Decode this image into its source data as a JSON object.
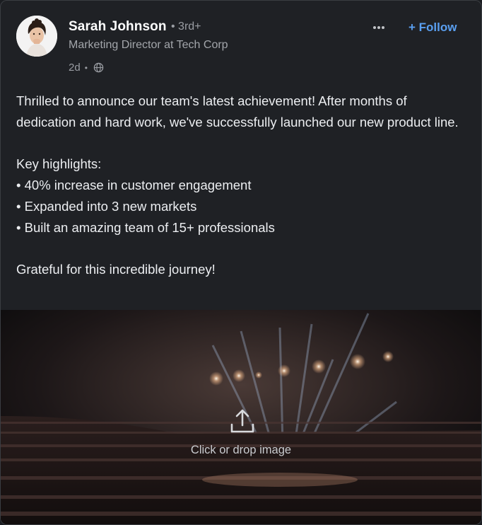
{
  "author": {
    "name": "Sarah Johnson",
    "degree": "3rd+",
    "headline": "Marketing Director at Tech Corp",
    "time": "2d",
    "visibility_icon": "globe-icon",
    "avatar_icon": "profile-photo"
  },
  "actions": {
    "more_icon": "ellipsis-icon",
    "follow_label": "+ Follow"
  },
  "post": {
    "intro": "Thrilled to announce our team's latest achievement! After months of dedication and hard work, we've successfully launched our new product line.",
    "highlights_title": "Key highlights:",
    "highlights": [
      "• 40% increase in customer engagement",
      "• Expanded into 3 new markets",
      "• Built an amazing team of 15+ professionals"
    ],
    "closing": "Grateful for this incredible journey!"
  },
  "media": {
    "upload_icon": "upload-icon",
    "upload_label": "Click or drop image"
  },
  "colors": {
    "card_bg": "#1f2125",
    "accent": "#5a9ff0",
    "text": "#eceef1",
    "muted": "#9a9da3"
  }
}
